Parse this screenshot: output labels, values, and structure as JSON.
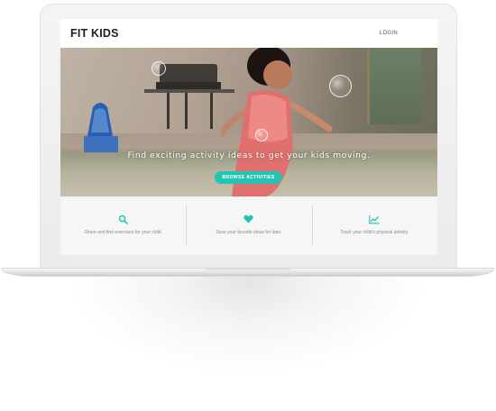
{
  "site": {
    "brand": "FIT KIDS",
    "login_label": "LOGIN"
  },
  "hero": {
    "headline": "Find exciting activity ideas to get your kids moving.",
    "button_label": "BROWSE ACTIVITIES"
  },
  "features": [
    {
      "icon": "search-icon",
      "text": "Share and find exercises for your child."
    },
    {
      "icon": "heart-icon",
      "text": "Save your favorite ideas for later."
    },
    {
      "icon": "line-chart-icon",
      "text": "Track your child's physical activity."
    }
  ],
  "colors": {
    "accent": "#23c3b4",
    "brand_text": "#1f1f1f",
    "feature_text": "#8a8a8a",
    "feature_bg": "#f6f6f6"
  }
}
